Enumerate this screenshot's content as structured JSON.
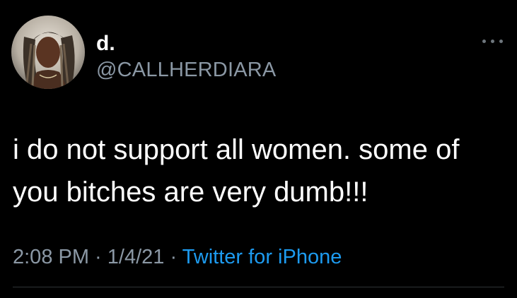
{
  "user": {
    "display_name": "d.",
    "handle": "@CALLHERDIARA",
    "avatar_icon": "profile-photo"
  },
  "tweet": {
    "text_lines": [
      "i do not support all women. some of",
      "you bitches are very dumb!!!"
    ]
  },
  "meta": {
    "time": "2:08 PM",
    "separator": " · ",
    "date": "1/4/21",
    "source": "Twitter for iPhone"
  },
  "icons": {
    "more": "more-options-icon"
  },
  "colors": {
    "background": "#000000",
    "text": "#ffffff",
    "secondary": "#8b98a5",
    "link": "#1d9bf0"
  }
}
